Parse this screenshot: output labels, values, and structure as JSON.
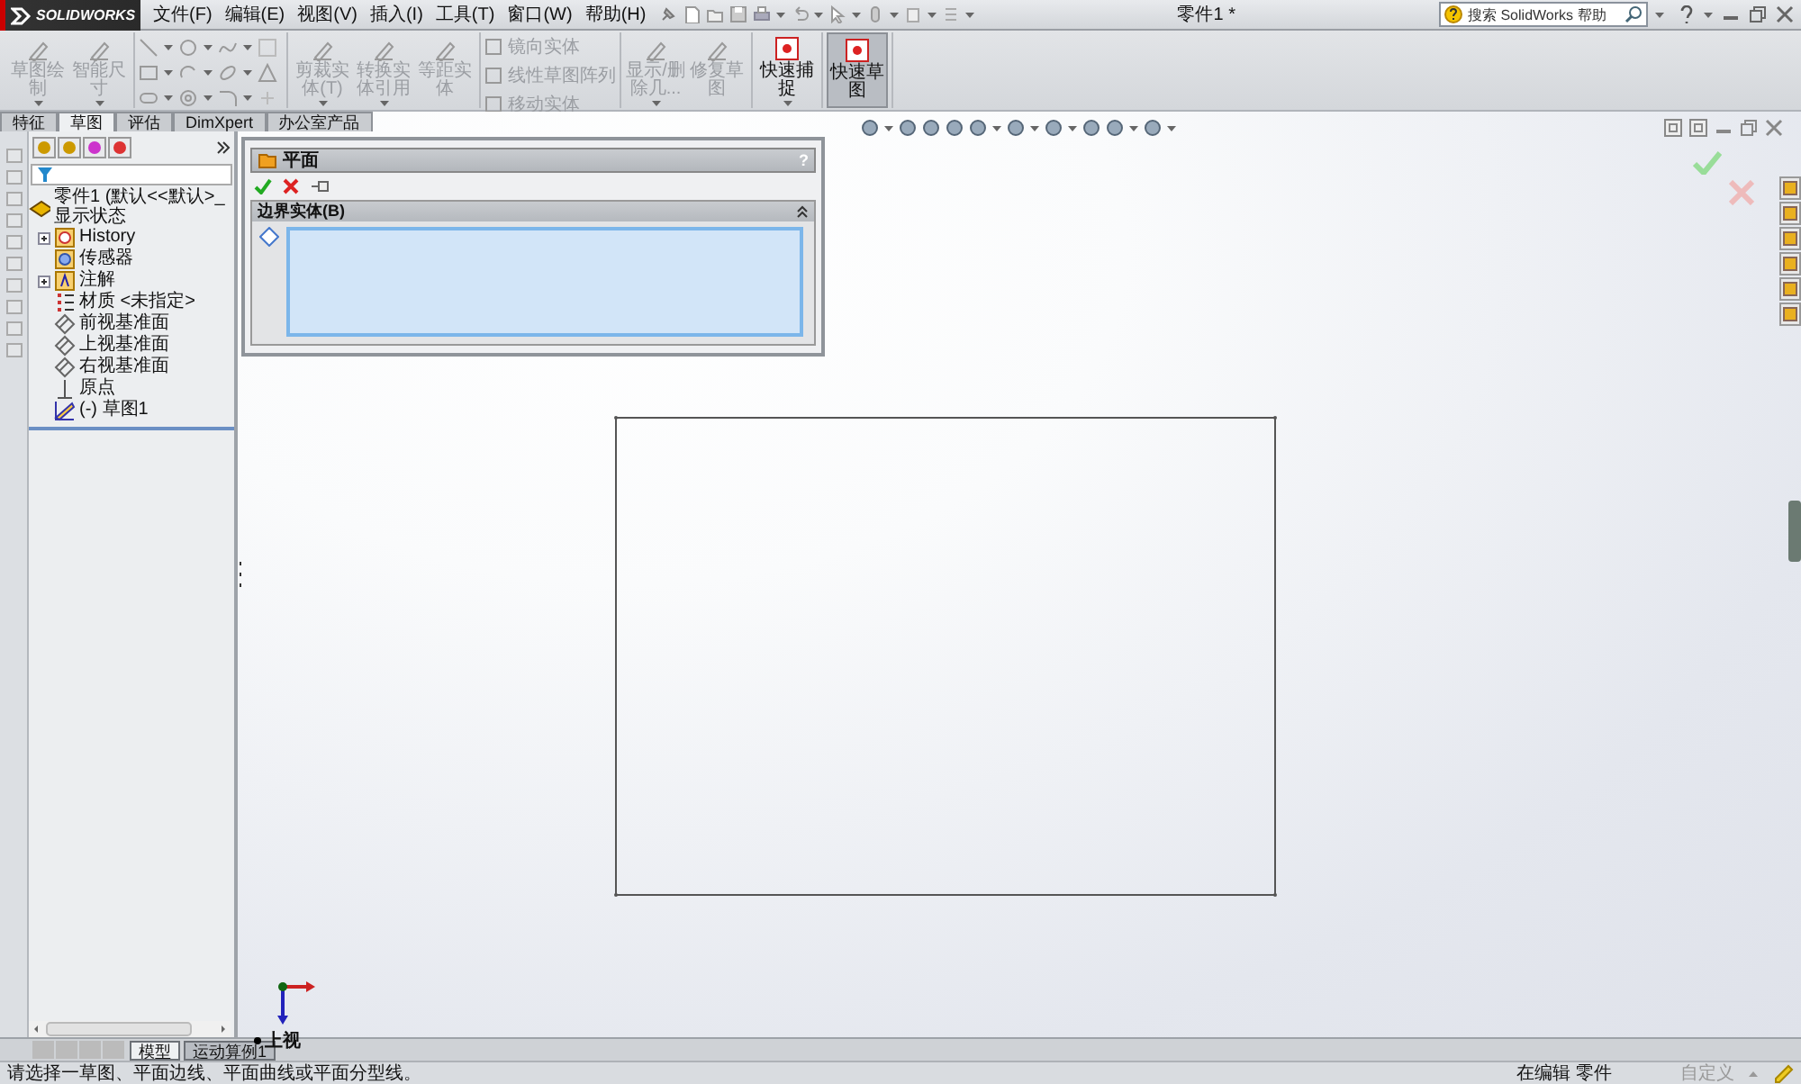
{
  "title_bar": {
    "logo": "SOLIDWORKS",
    "menus": [
      "文件(F)",
      "编辑(E)",
      "视图(V)",
      "插入(I)",
      "工具(T)",
      "窗口(W)",
      "帮助(H)"
    ],
    "document_title": "零件1 *",
    "search": {
      "placeholder": "搜索 SolidWorks 帮助"
    }
  },
  "ribbon": {
    "groups": [
      {
        "kind": "large",
        "items": [
          {
            "label": "草图绘制",
            "disabled": true,
            "pressed": false,
            "dropdown": true
          },
          {
            "label": "智能尺寸",
            "disabled": true,
            "pressed": false,
            "dropdown": true
          }
        ]
      },
      {
        "kind": "icon_grid"
      },
      {
        "kind": "large",
        "items": [
          {
            "label": "剪裁实体(T)",
            "disabled": true,
            "pressed": false,
            "dropdown": true
          },
          {
            "label": "转换实体引用",
            "disabled": true,
            "pressed": false,
            "dropdown": true
          },
          {
            "label": "等距实体",
            "disabled": true,
            "pressed": false,
            "dropdown": false
          }
        ]
      },
      {
        "kind": "list",
        "items": [
          {
            "label": "镜向实体",
            "disabled": true
          },
          {
            "label": "线性草图阵列",
            "disabled": true
          },
          {
            "label": "移动实体",
            "disabled": true
          }
        ]
      },
      {
        "kind": "large",
        "items": [
          {
            "label": "显示/删除几...",
            "disabled": true,
            "pressed": false,
            "dropdown": true
          },
          {
            "label": "修复草图",
            "disabled": true,
            "pressed": false,
            "dropdown": false
          }
        ]
      },
      {
        "kind": "large",
        "items": [
          {
            "label": "快速捕捉",
            "disabled": false,
            "pressed": false,
            "dropdown": true
          }
        ]
      },
      {
        "kind": "large",
        "items": [
          {
            "label": "快速草图",
            "disabled": false,
            "pressed": true,
            "dropdown": false
          }
        ]
      }
    ]
  },
  "command_tabs": [
    {
      "label": "特征",
      "selected": false
    },
    {
      "label": "草图",
      "selected": true
    },
    {
      "label": "评估",
      "selected": false
    },
    {
      "label": "DimXpert",
      "selected": false
    },
    {
      "label": "办公室产品",
      "selected": false
    }
  ],
  "feature_tree": {
    "root": {
      "label": "零件1  (默认<<默认>_显示状态",
      "kind": "part",
      "children": [
        {
          "label": "History",
          "kind": "history",
          "collapsed": true
        },
        {
          "label": "传感器",
          "kind": "sensor",
          "collapsed": false
        },
        {
          "label": "注解",
          "kind": "annotation",
          "collapsed": true
        },
        {
          "label": "材质 <未指定>",
          "kind": "material",
          "collapsed": false
        },
        {
          "label": "前视基准面",
          "kind": "plane",
          "collapsed": false
        },
        {
          "label": "上视基准面",
          "kind": "plane",
          "collapsed": false
        },
        {
          "label": "右视基准面",
          "kind": "plane",
          "collapsed": false
        },
        {
          "label": "原点",
          "kind": "origin",
          "collapsed": false
        },
        {
          "label": "(-) 草图1",
          "kind": "sketch",
          "collapsed": false
        }
      ]
    }
  },
  "property_manager": {
    "title": "平面",
    "help": "?",
    "section": {
      "title": "边界实体(B)"
    }
  },
  "viewport": {
    "view_label": "上视"
  },
  "bottom_tabs": [
    {
      "label": "模型",
      "selected": true
    },
    {
      "label": "运动算例1",
      "selected": false
    }
  ],
  "status_bar": {
    "message": "请选择一草图、平面边线、平面曲线或平面分型线。",
    "mode": "在编辑 零件",
    "units": "自定义"
  }
}
